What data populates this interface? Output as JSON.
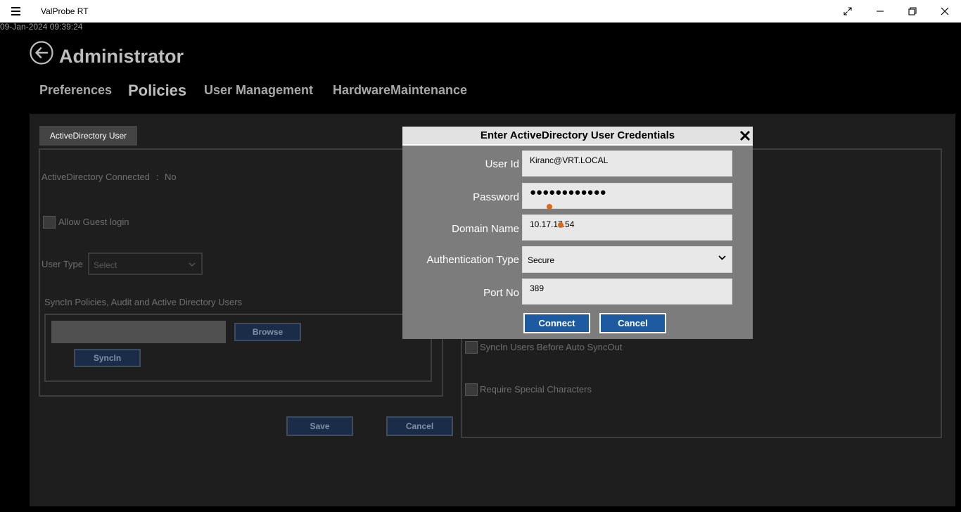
{
  "window": {
    "title": "ValProbe RT",
    "timestamp": "09-Jan-2024 09:39:24"
  },
  "header": {
    "title": "Administrator",
    "tabs": [
      {
        "label": "Preferences"
      },
      {
        "label": "Policies"
      },
      {
        "label": "User Management"
      },
      {
        "label": "HardwareMaintenance"
      }
    ],
    "active_tab": "Policies"
  },
  "policies": {
    "subtab_label": "ActiveDirectory User",
    "ad_connected_label": "ActiveDirectory Connected",
    "ad_connected_sep": ":",
    "ad_connected_value": "No",
    "allow_guest_label": "Allow Guest login",
    "user_type_label": "User Type",
    "user_type_placeholder": "Select",
    "sync_section_label": "SyncIn Policies, Audit and Active Directory Users",
    "browse_label": "Browse",
    "syncin_label": "SyncIn",
    "save_label": "Save",
    "cancel_label": "Cancel",
    "sync_before_autosync_label": "SyncIn Users Before Auto SyncOut",
    "require_special_label": "Require Special Characters"
  },
  "dialog": {
    "title": "Enter ActiveDirectory User Credentials",
    "user_id_label": "User Id",
    "user_id_value": "Kiranc@VRT.LOCAL",
    "password_label": "Password",
    "password_value": "●●●●●●●●●●●●",
    "domain_label": "Domain Name",
    "domain_value": "10.17.17.54",
    "auth_label": "Authentication Type",
    "auth_value": "Secure",
    "port_label": "Port No",
    "port_value": "389",
    "connect_label": "Connect",
    "cancel_label": "Cancel"
  },
  "colors": {
    "accent": "#1e5aa0",
    "background": "#000000",
    "panel": "#1e1e1e",
    "dialog": "#7c7c7c"
  }
}
